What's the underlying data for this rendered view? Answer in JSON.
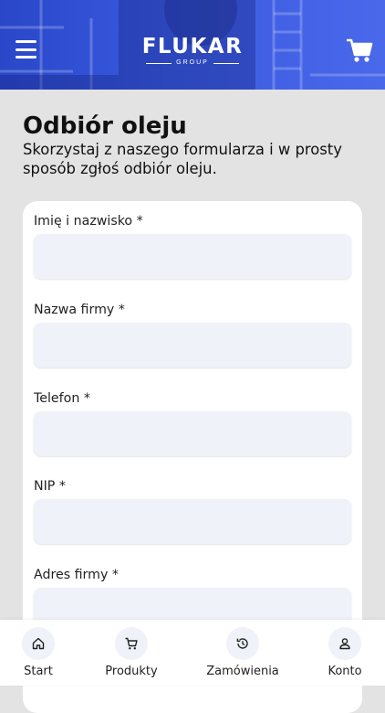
{
  "header": {
    "logo_main": "FLUKAR",
    "logo_sub": "GROUP"
  },
  "page": {
    "title": "Odbiór oleju",
    "description": "Skorzystaj z naszego formularza i w prosty sposób zgłoś odbiór oleju."
  },
  "form": {
    "fields": [
      {
        "label": "Imię i nazwisko *",
        "value": ""
      },
      {
        "label": "Nazwa firmy *",
        "value": ""
      },
      {
        "label": "Telefon *",
        "value": ""
      },
      {
        "label": "NIP *",
        "value": ""
      },
      {
        "label": "Adres firmy *",
        "value": ""
      }
    ]
  },
  "nav": {
    "items": [
      {
        "label": "Start",
        "icon": "home-icon"
      },
      {
        "label": "Produkty",
        "icon": "cart-icon"
      },
      {
        "label": "Zamówienia",
        "icon": "history-icon"
      },
      {
        "label": "Konto",
        "icon": "user-icon"
      }
    ]
  },
  "colors": {
    "brand_blue": "#3a5ae0",
    "page_background": "#e3e3e3",
    "input_background": "#eff2f8"
  }
}
